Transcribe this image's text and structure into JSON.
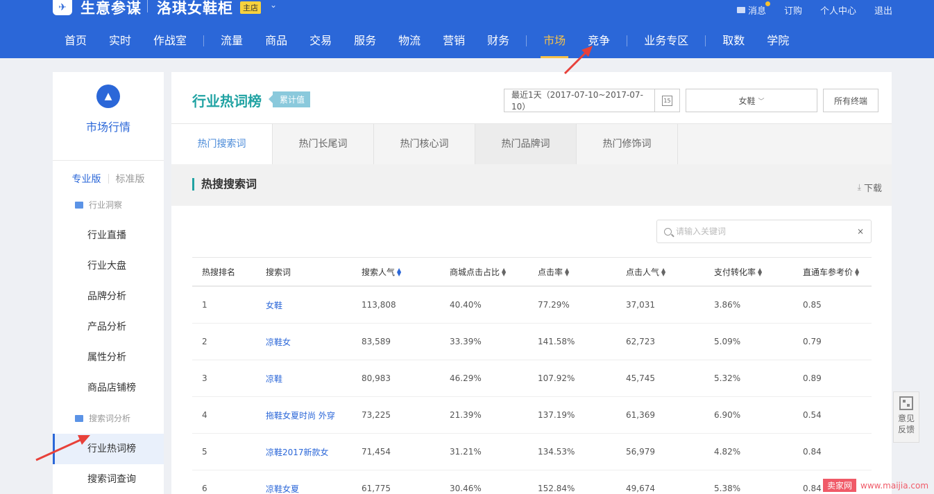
{
  "header": {
    "brand": "生意参谋",
    "shop_name": "洛琪女鞋柜",
    "shop_badge": "主店",
    "top_links": [
      "消息",
      "订购",
      "个人中心",
      "退出"
    ],
    "nav": [
      "首页",
      "实时",
      "作战室",
      "流量",
      "商品",
      "交易",
      "服务",
      "物流",
      "营销",
      "财务",
      "市场",
      "竞争",
      "业务专区",
      "取数",
      "学院"
    ],
    "active_nav": "市场"
  },
  "sidebar": {
    "title": "市场行情",
    "versions": [
      "专业版",
      "标准版"
    ],
    "group1": "行业洞察",
    "group1_items": [
      "行业直播",
      "行业大盘",
      "品牌分析",
      "产品分析",
      "属性分析",
      "商品店铺榜"
    ],
    "group2": "搜索词分析",
    "group2_items": [
      "行业热词榜",
      "搜索词查询"
    ],
    "active_item": "行业热词榜"
  },
  "main": {
    "title": "行业热词榜",
    "tag": "累计值",
    "date_range": "最近1天（2017-07-10~2017-07-10）",
    "calendar_day": "15",
    "category": "女鞋",
    "terminal": "所有终端",
    "tabs": [
      "热门搜索词",
      "热门长尾词",
      "热门核心词",
      "热门品牌词",
      "热门修饰词"
    ],
    "section_title": "热搜搜索词",
    "download": "下载",
    "search_placeholder": "请输入关键词",
    "clear": "×"
  },
  "table": {
    "columns": [
      "热搜排名",
      "搜索词",
      "搜索人气",
      "商城点击占比",
      "点击率",
      "点击人气",
      "支付转化率",
      "直通车参考价"
    ],
    "rows": [
      [
        "1",
        "女鞋",
        "113,808",
        "40.40%",
        "77.29%",
        "37,031",
        "3.86%",
        "0.85"
      ],
      [
        "2",
        "凉鞋女",
        "83,589",
        "33.39%",
        "141.58%",
        "62,723",
        "5.09%",
        "0.79"
      ],
      [
        "3",
        "凉鞋",
        "80,983",
        "46.29%",
        "107.92%",
        "45,745",
        "5.32%",
        "0.89"
      ],
      [
        "4",
        "拖鞋女夏时尚 外穿",
        "73,225",
        "21.39%",
        "137.19%",
        "61,369",
        "6.90%",
        "0.54"
      ],
      [
        "5",
        "凉鞋2017新款女",
        "71,454",
        "31.21%",
        "134.53%",
        "56,979",
        "4.82%",
        "0.84"
      ],
      [
        "6",
        "凉鞋女夏",
        "61,775",
        "30.46%",
        "152.84%",
        "49,674",
        "5.38%",
        "0.84"
      ]
    ]
  },
  "feedback": [
    "意见",
    "反馈"
  ],
  "watermark": {
    "logo": "卖家网",
    "url": "www.maijia.com"
  },
  "colors": {
    "header": "#2b67d8",
    "accent": "#21a3a3",
    "active_nav": "#f7c24a",
    "arrow": "#e8413a"
  }
}
